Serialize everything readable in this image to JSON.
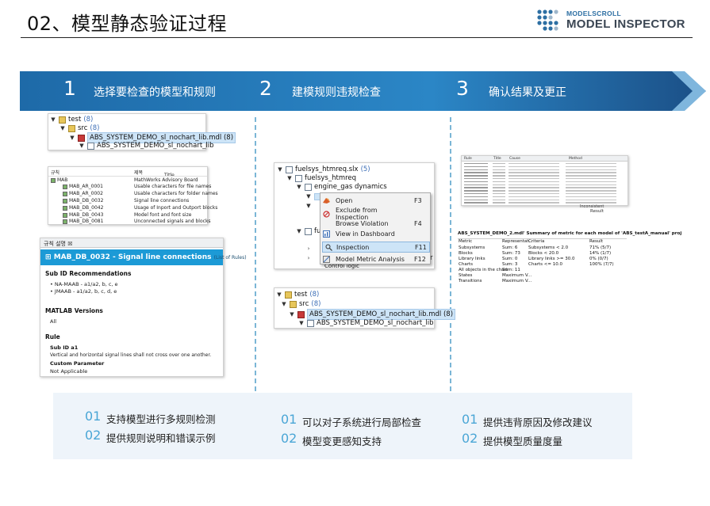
{
  "title": "02、模型静态验证过程",
  "logo": {
    "sub": "MODELSCROLL",
    "main": "MODEL INSPECTOR"
  },
  "steps": [
    {
      "num": "1",
      "label": "选择要检查的模型和规则"
    },
    {
      "num": "2",
      "label": "建模规则违规检查"
    },
    {
      "num": "3",
      "label": "确认结果及更正"
    }
  ],
  "tree1": {
    "test": "test",
    "test_count": "(8)",
    "src": "src",
    "src_count": "(8)",
    "lib": "ABS_SYSTEM_DEMO_sl_nochart_lib.mdl (8)",
    "lib_child": "ABS_SYSTEM_DEMO_sl_nochart_lib"
  },
  "rules_table": {
    "col_rule": "규칙",
    "col_title": "제목",
    "col_title2": "Title",
    "root_id": "MAB",
    "root_title": "MathWorks Advisory Board",
    "rows": [
      {
        "id": "MAB_AR_0001",
        "title": "Usable characters for file names"
      },
      {
        "id": "MAB_AR_0002",
        "title": "Usable characters for folder names"
      },
      {
        "id": "MAB_DB_0032",
        "title": "Signal line connections"
      },
      {
        "id": "MAB_DB_0042",
        "title": "Usage of Inport and Outport blocks"
      },
      {
        "id": "MAB_DB_0043",
        "title": "Model font and font size"
      },
      {
        "id": "MAB_DB_0081",
        "title": "Unconnected signals and blocks"
      }
    ]
  },
  "detail": {
    "tab": "규칙 설명",
    "heading": "MAB_DB_0032 - Signal line connections",
    "heading_tag": "(List of Rules)",
    "sub_id_title": "Sub ID Recommendations",
    "bullets": [
      "NA-MAAB - a1/a2, b, c, e",
      "JMAAB - a1/a2, b, c, d, e"
    ],
    "matlab_title": "MATLAB Versions",
    "matlab_value": "All",
    "rule_title": "Rule",
    "sub_id": "Sub ID a1",
    "rule_text": "Vertical and horizontal signal lines shall not cross over one another.",
    "custom_param": "Custom Parameter",
    "not_applicable": "Not Applicable"
  },
  "tree2": {
    "root": "fuelsys_htmreq.slx",
    "root_count": "(5)",
    "child": "fuelsys_htmreq",
    "engine": "engine_gas dynamics",
    "fu": "fu",
    "trailing": "r",
    "last": "Control logic"
  },
  "context_menu": [
    {
      "label": "Open",
      "key": "F3"
    },
    {
      "label": "Exclude from Inspection",
      "key": ""
    },
    {
      "label": "Browse Violation",
      "key": "F4"
    },
    {
      "label": "View in Dashboard",
      "key": ""
    },
    {
      "label": "Inspection",
      "key": "F11"
    },
    {
      "label": "Model Metric Analysis",
      "key": "F12"
    }
  ],
  "tree3": {
    "test": "test",
    "test_count": "(8)",
    "src": "src",
    "src_count": "(8)",
    "lib": "ABS_SYSTEM_DEMO_sl_nochart_lib.mdl (8)",
    "lib_child": "ABS_SYSTEM_DEMO_sl_nochart_lib"
  },
  "violations_table": {
    "headers": [
      "Rule",
      "Title",
      "Cause",
      "Method"
    ],
    "result_label": "Result",
    "first_cell": "Inconsistent"
  },
  "metric_table": {
    "title": "ABS_SYSTEM_DEMO_2.mdl' Summary of metric for each model of 'ABS_testA_manual' proj",
    "headers": [
      "Metric",
      "Representat...",
      "Criteria",
      "Result"
    ],
    "rows": [
      [
        "Subsystems",
        "Sum: 6",
        "Subsystems < 2.0",
        "71% (5/7)"
      ],
      [
        "Blocks",
        "Sum: 73",
        "Blocks < 20.0",
        "14% (1/7)"
      ],
      [
        "Library links",
        "Sum: 0",
        "Library links >= 30.0",
        "0% (0/7)"
      ],
      [
        "Charts",
        "Sum: 3",
        "Charts <= 10.0",
        "100% (7/7)"
      ],
      [
        "All objects in the chart",
        "Sum: 11",
        "",
        ""
      ],
      [
        "States",
        "Maximum V...",
        "",
        ""
      ],
      [
        "Transitions",
        "Maximum V...",
        "",
        ""
      ]
    ]
  },
  "bottom": {
    "col1": [
      {
        "num": "01",
        "text": "支持模型进行多规则检测"
      },
      {
        "num": "02",
        "text": "提供规则说明和错误示例"
      }
    ],
    "col2": [
      {
        "num": "01",
        "text": "可以对子系统进行局部检查"
      },
      {
        "num": "02",
        "text": "模型变更感知支持"
      }
    ],
    "col3": [
      {
        "num": "01",
        "text": "提供违背原因及修改建议"
      },
      {
        "num": "02",
        "text": "提供模型质量度量"
      }
    ]
  },
  "colors": {
    "banner_dark": "#1c5f9a",
    "banner_light": "#2b8fcf",
    "accent": "#1c9ad6"
  }
}
